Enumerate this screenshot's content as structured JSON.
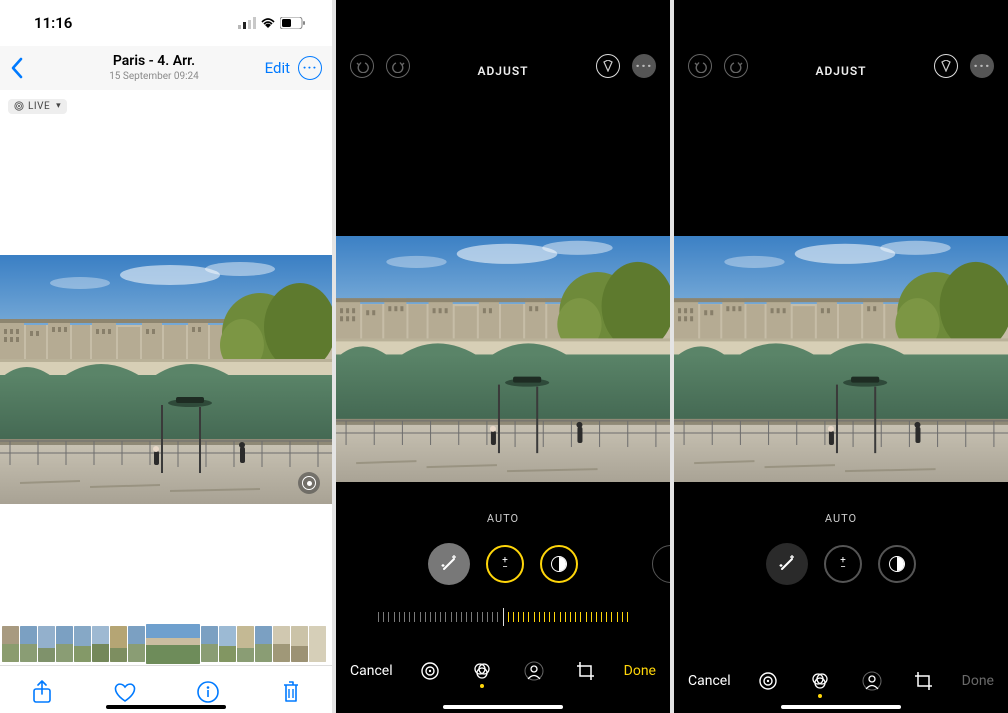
{
  "status": {
    "time": "11:16"
  },
  "viewer": {
    "title": "Paris - 4. Arr.",
    "subtitle": "15 September  09:24",
    "edit_label": "Edit",
    "live_badge": "LIVE"
  },
  "editor": {
    "header": "ADJUST",
    "adjust_label": "AUTO",
    "cancel": "Cancel",
    "done": "Done"
  },
  "tools": {
    "auto": "auto-wand",
    "exposure": "exposure",
    "brilliance": "brilliance",
    "highlights": "highlights"
  },
  "bottom_tabs": [
    "adjust",
    "filters",
    "portrait",
    "crop"
  ]
}
